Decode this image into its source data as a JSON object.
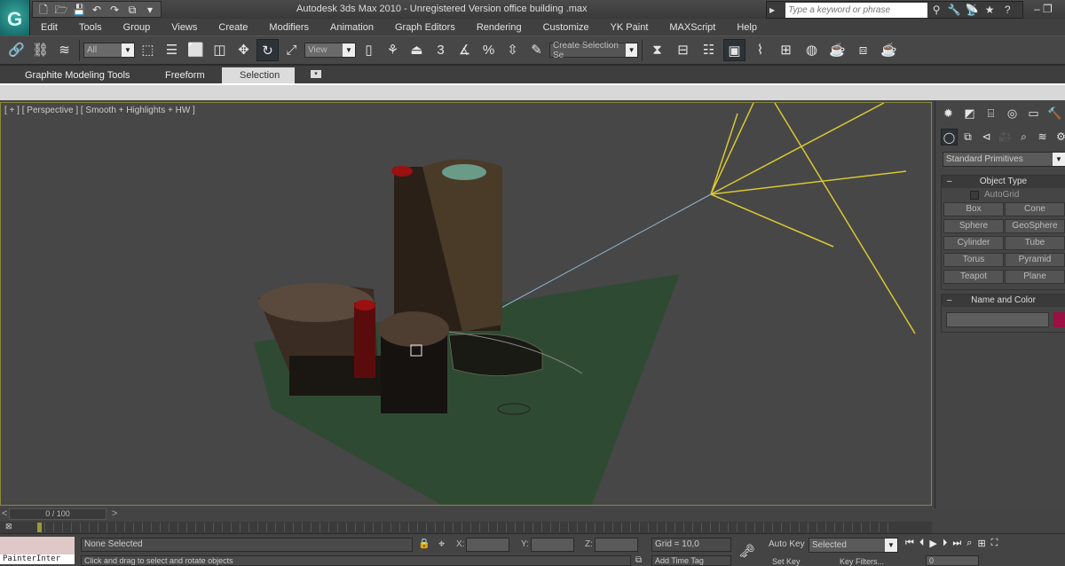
{
  "app": {
    "title": "Autodesk 3ds Max  2010  - Unregistered Version     office building .max",
    "logo_glyph": "G",
    "search_placeholder": "Type a keyword or phrase",
    "window_controls": "– ❐"
  },
  "quick_access": [
    {
      "name": "new-file-icon",
      "glyph": "🗋"
    },
    {
      "name": "open-file-icon",
      "glyph": "🗁"
    },
    {
      "name": "save-icon",
      "glyph": "💾"
    },
    {
      "name": "undo-icon",
      "glyph": "↶"
    },
    {
      "name": "redo-icon",
      "glyph": "↷"
    },
    {
      "name": "project-folder-icon",
      "glyph": "⧉"
    },
    {
      "name": "dropdown-arrow-icon",
      "glyph": "▾"
    }
  ],
  "search_tools": [
    {
      "name": "binoculars-icon",
      "glyph": "⚲"
    },
    {
      "name": "wrench-icon",
      "glyph": "🔧"
    },
    {
      "name": "satellite-icon",
      "glyph": "📡"
    },
    {
      "name": "star-icon",
      "glyph": "★"
    },
    {
      "name": "help-icon",
      "glyph": "?"
    }
  ],
  "menu": [
    "Edit",
    "Tools",
    "Group",
    "Views",
    "Create",
    "Modifiers",
    "Animation",
    "Graph Editors",
    "Rendering",
    "Customize",
    "YK Paint",
    "MAXScript",
    "Help"
  ],
  "toolbar": {
    "selection_filter": "All",
    "ref_coord": "View",
    "named_selection": "Create Selection Se",
    "group1": [
      {
        "name": "select-and-link-icon",
        "glyph": "🔗"
      },
      {
        "name": "unlink-icon",
        "glyph": "⛓"
      },
      {
        "name": "bind-space-warp-icon",
        "glyph": "≋"
      }
    ],
    "group2": [
      {
        "name": "select-object-icon",
        "glyph": "⬚"
      },
      {
        "name": "select-by-name-icon",
        "glyph": "☰"
      },
      {
        "name": "rectangular-selection-icon",
        "glyph": "⬜"
      },
      {
        "name": "window-crossing-icon",
        "glyph": "◫"
      },
      {
        "name": "select-and-move-icon",
        "glyph": "✥"
      },
      {
        "name": "select-and-rotate-icon",
        "glyph": "↻",
        "active": true
      },
      {
        "name": "select-and-scale-icon",
        "glyph": "⤢"
      }
    ],
    "group3": [
      {
        "name": "use-pivot-center-icon",
        "glyph": "▯"
      },
      {
        "name": "select-manipulate-icon",
        "glyph": "⚘"
      },
      {
        "name": "keyboard-shortcut-override-icon",
        "glyph": "⏏"
      },
      {
        "name": "snaps-toggle-icon",
        "glyph": "3"
      },
      {
        "name": "angle-snap-icon",
        "glyph": "∡"
      },
      {
        "name": "percent-snap-icon",
        "glyph": "%"
      },
      {
        "name": "spinner-snap-icon",
        "glyph": "⇳"
      },
      {
        "name": "edit-named-selection-icon",
        "glyph": "✎"
      }
    ],
    "group4": [
      {
        "name": "mirror-icon",
        "glyph": "⧗"
      },
      {
        "name": "align-icon",
        "glyph": "⊟"
      },
      {
        "name": "layer-manager-icon",
        "glyph": "☷"
      },
      {
        "name": "graphite-toggle-icon",
        "glyph": "▣",
        "active": true
      },
      {
        "name": "curve-editor-icon",
        "glyph": "⌇"
      },
      {
        "name": "schematic-view-icon",
        "glyph": "⊞"
      },
      {
        "name": "material-editor-icon",
        "glyph": "◍"
      },
      {
        "name": "render-setup-icon",
        "glyph": "☕"
      },
      {
        "name": "rendered-frame-window-icon",
        "glyph": "⧈"
      },
      {
        "name": "render-production-icon",
        "glyph": "☕"
      }
    ]
  },
  "ribbon": {
    "tabs": [
      {
        "label": "Graphite Modeling Tools"
      },
      {
        "label": "Freeform"
      },
      {
        "label": "Selection",
        "active": true
      }
    ],
    "options_glyph": "▾"
  },
  "viewport": {
    "label": "[ + ] [ Perspective ] [ Smooth + Highlights + HW ]"
  },
  "command_panel": {
    "tabs": [
      {
        "name": "create-tab-icon",
        "glyph": "✹"
      },
      {
        "name": "modify-tab-icon",
        "glyph": "◩"
      },
      {
        "name": "hierarchy-tab-icon",
        "glyph": "⌸"
      },
      {
        "name": "motion-tab-icon",
        "glyph": "◎"
      },
      {
        "name": "display-tab-icon",
        "glyph": "▭"
      },
      {
        "name": "utilities-tab-icon",
        "glyph": "🔨"
      }
    ],
    "categories": [
      {
        "name": "geometry-icon",
        "glyph": "◯"
      },
      {
        "name": "shapes-icon",
        "glyph": "⧉"
      },
      {
        "name": "lights-icon",
        "glyph": "⊲"
      },
      {
        "name": "cameras-icon",
        "glyph": "🎥"
      },
      {
        "name": "helpers-icon",
        "glyph": "⌕"
      },
      {
        "name": "space-warps-icon",
        "glyph": "≋"
      },
      {
        "name": "systems-icon",
        "glyph": "⚙"
      }
    ],
    "primitive_type": "Standard Primitives",
    "object_type": {
      "title": "Object Type",
      "autogrid": "AutoGrid",
      "autogrid_checked": false,
      "buttons": [
        "Box",
        "Cone",
        "Sphere",
        "GeoSphere",
        "Cylinder",
        "Tube",
        "Torus",
        "Pyramid",
        "Teapot",
        "Plane"
      ]
    },
    "name_and_color": {
      "title": "Name and Color",
      "name_value": "",
      "color": "#9a1040"
    },
    "collapse_glyph": "–"
  },
  "timeline": {
    "frame": "0 / 100",
    "prev": "<",
    "next": ">"
  },
  "status": {
    "listener": "PainterInter",
    "selection": "None Selected",
    "prompt": "Click and drag to select and rotate objects",
    "x_label": "X:",
    "y_label": "Y:",
    "z_label": "Z:",
    "x": "",
    "y": "",
    "z": "",
    "grid": "Grid = 10,0",
    "add_time_tag": "Add Time Tag",
    "auto_key": "Auto Key",
    "set_key": "Set Key",
    "key_mode": "Selected",
    "key_filters": "Key Filters...",
    "current_frame": "0"
  },
  "colors": {
    "accent_teal": "#1a7a78",
    "light_lines": "#d8c832",
    "camera_line": "#8fb4d0",
    "ground": "#2f4a33",
    "red_caps": "#9b1010"
  }
}
